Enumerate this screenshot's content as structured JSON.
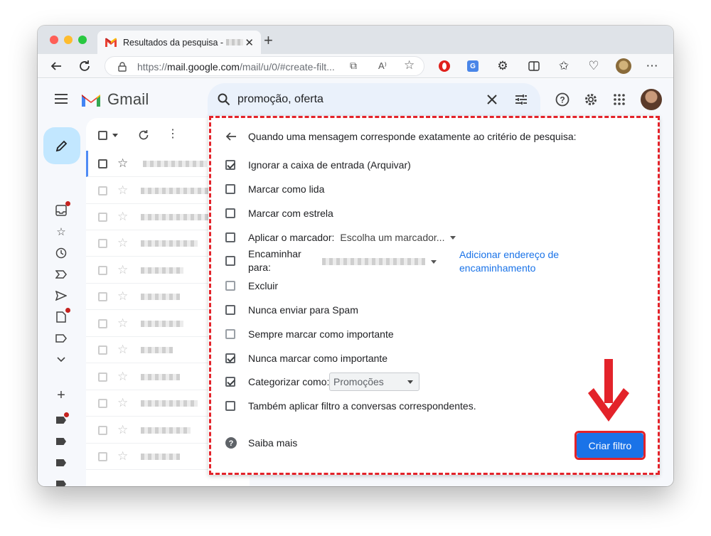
{
  "browser": {
    "tab_title": "Resultados da pesquisa -",
    "tab_close": "✕",
    "new_tab": "+",
    "url_host_prefix": "https://",
    "url_host": "mail.google.com",
    "url_path": "/mail/u/0/#create-filt...",
    "traffic_colors": [
      "#ff5f57",
      "#febc2e",
      "#28c840"
    ]
  },
  "gmail": {
    "brand": "Gmail",
    "search_query": "promoção, oferta",
    "icons": [
      "menu-icon",
      "search-icon",
      "close-icon",
      "tune-icon",
      "help-icon",
      "settings-icon",
      "apps-icon"
    ]
  },
  "filter": {
    "header": "Quando uma mensagem corresponde exatamente ao critério de pesquisa:",
    "options": {
      "skip_inbox": "Ignorar a caixa de entrada (Arquivar)",
      "mark_read": "Marcar como lida",
      "star": "Marcar com estrela",
      "apply_label": "Aplicar o marcador:",
      "apply_label_select": "Escolha um marcador...",
      "forward_line1": "Encaminhar",
      "forward_line2": "para:",
      "add_forward": "Adicionar endereço de encaminhamento",
      "delete": "Excluir",
      "never_spam": "Nunca enviar para Spam",
      "always_important": "Sempre marcar como importante",
      "never_important": "Nunca marcar como importante",
      "categorize": "Categorizar como:",
      "categorize_select": "Promoções",
      "apply_existing": "Também aplicar filtro a conversas correspondentes."
    },
    "learn_more": "Saiba mais",
    "create_button": "Criar filtro"
  },
  "colors": {
    "accent_blue": "#1a73e8",
    "annotation_red": "#e3232a",
    "compose_bg": "#c2e7ff"
  }
}
